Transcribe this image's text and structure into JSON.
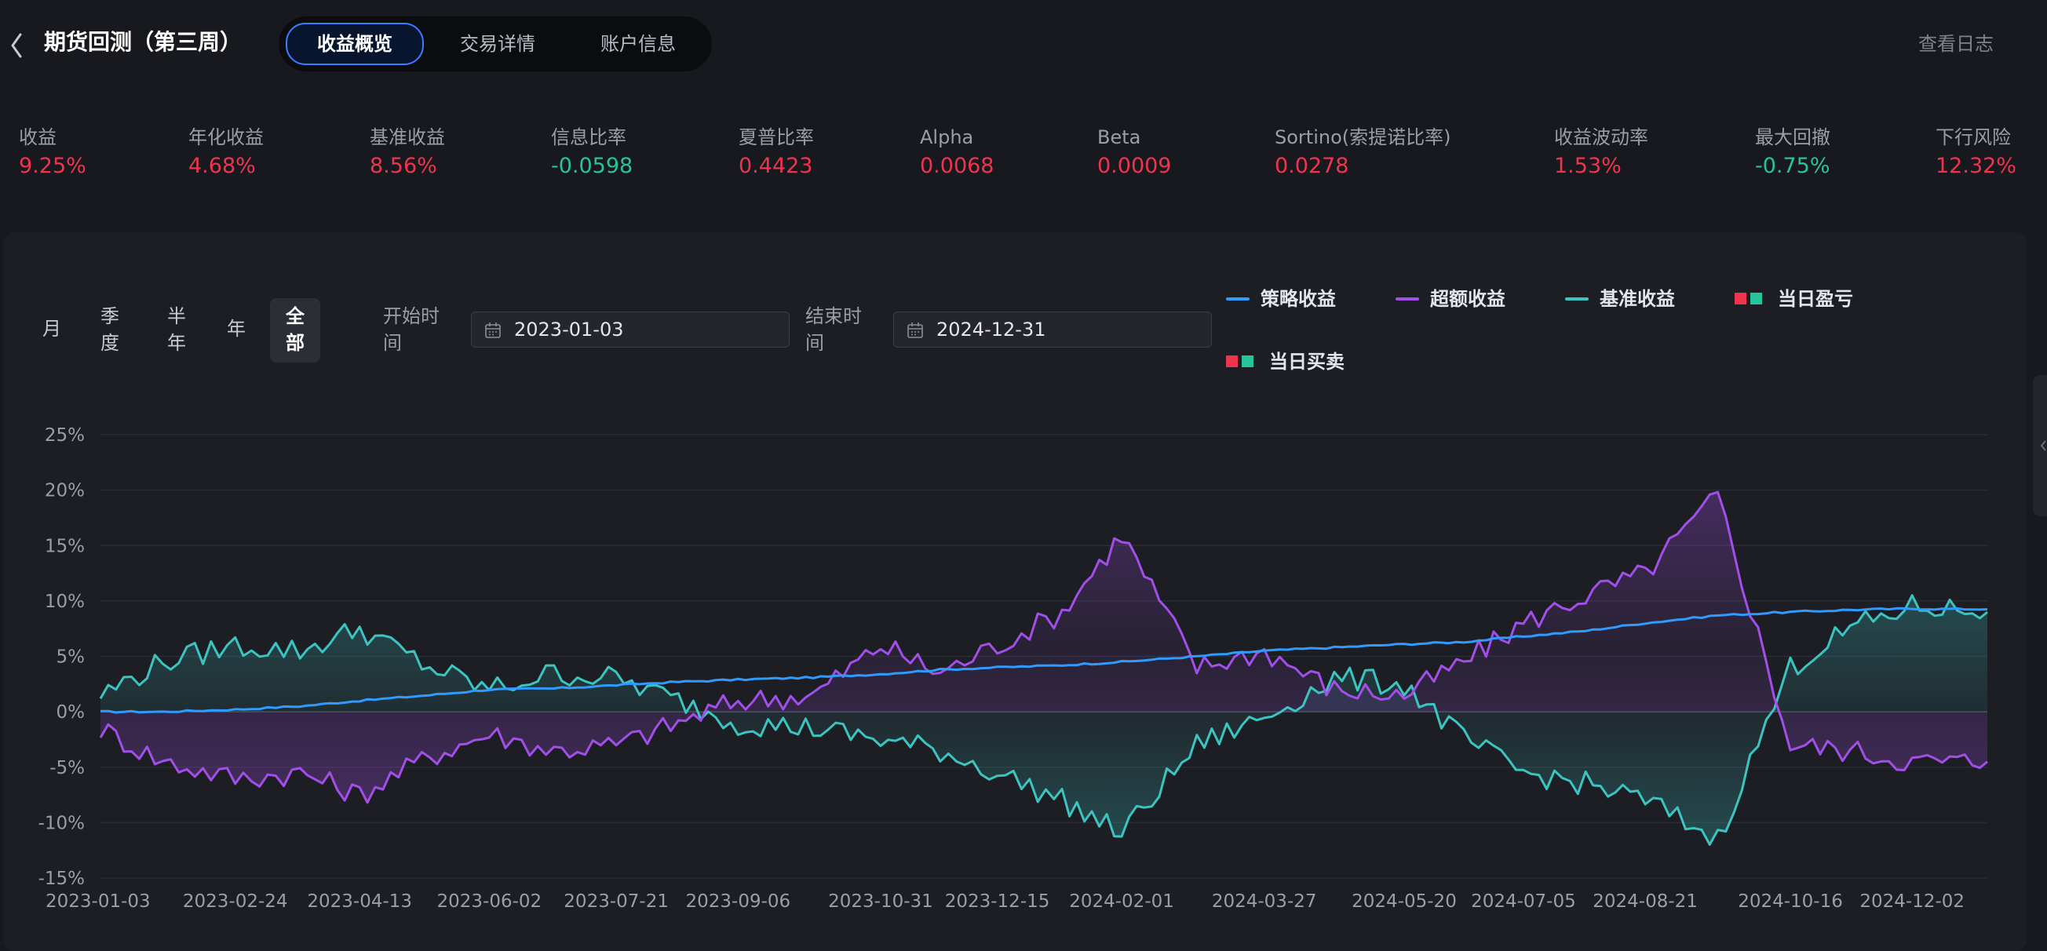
{
  "header": {
    "title": "期货回测（第三周）",
    "tabs": [
      {
        "label": "收益概览",
        "active": true
      },
      {
        "label": "交易详情",
        "active": false
      },
      {
        "label": "账户信息",
        "active": false
      }
    ],
    "log_button": "查看日志"
  },
  "metrics": [
    {
      "label": "收益",
      "value": "9.25%",
      "tone": "red"
    },
    {
      "label": "年化收益",
      "value": "4.68%",
      "tone": "red"
    },
    {
      "label": "基准收益",
      "value": "8.56%",
      "tone": "red"
    },
    {
      "label": "信息比率",
      "value": "-0.0598",
      "tone": "green"
    },
    {
      "label": "夏普比率",
      "value": "0.4423",
      "tone": "red"
    },
    {
      "label": "Alpha",
      "value": "0.0068",
      "tone": "red"
    },
    {
      "label": "Beta",
      "value": "0.0009",
      "tone": "red"
    },
    {
      "label": "Sortino(索提诺比率)",
      "value": "0.0278",
      "tone": "red"
    },
    {
      "label": "收益波动率",
      "value": "1.53%",
      "tone": "red"
    },
    {
      "label": "最大回撤",
      "value": "-0.75%",
      "tone": "green"
    },
    {
      "label": "下行风险",
      "value": "12.32%",
      "tone": "red"
    }
  ],
  "periods": [
    {
      "label": "月",
      "active": false
    },
    {
      "label": "季度",
      "active": false
    },
    {
      "label": "半年",
      "active": false
    },
    {
      "label": "年",
      "active": false
    },
    {
      "label": "全部",
      "active": true
    }
  ],
  "date_range": {
    "start_label": "开始时间",
    "start_value": "2023-01-03",
    "end_label": "结束时间",
    "end_value": "2024-12-31"
  },
  "colors": {
    "strategy": "#2f9bff",
    "excess": "#a24ee8",
    "benchmark": "#3bc4c0",
    "up": "#f0344f",
    "down": "#26c49a"
  },
  "legend": [
    {
      "label": "策略收益",
      "kind": "line",
      "color": "#2f9bff"
    },
    {
      "label": "超额收益",
      "kind": "line",
      "color": "#a24ee8"
    },
    {
      "label": "基准收益",
      "kind": "line",
      "color": "#3bc4c0"
    },
    {
      "label": "当日盈亏",
      "kind": "squares"
    },
    {
      "label": "当日买卖",
      "kind": "squares"
    }
  ],
  "chart_data": {
    "type": "line",
    "title": "",
    "xlabel": "",
    "ylabel": "",
    "ylim": [
      -15,
      25
    ],
    "y_ticks": [
      "25%",
      "20%",
      "15%",
      "10%",
      "5%",
      "0%",
      "-5%",
      "-10%",
      "-15%"
    ],
    "x_ticks": [
      "2023-01-03",
      "2023-02-24",
      "2023-04-13",
      "2023-06-02",
      "2023-07-21",
      "2023-09-06",
      "2023-10-31",
      "2023-12-15",
      "2024-02-01",
      "2024-03-27",
      "2024-05-20",
      "2024-07-05",
      "2024-08-21",
      "2024-10-16",
      "2024-12-02"
    ],
    "grid": true,
    "legend_position": "top-right",
    "x": [
      "2023-01-03",
      "2023-01-27",
      "2023-02-24",
      "2023-03-21",
      "2023-04-13",
      "2023-05-10",
      "2023-06-02",
      "2023-06-27",
      "2023-07-21",
      "2023-08-14",
      "2023-09-06",
      "2023-10-05",
      "2023-10-31",
      "2023-11-23",
      "2023-12-15",
      "2024-01-09",
      "2024-02-01",
      "2024-03-01",
      "2024-03-27",
      "2024-04-23",
      "2024-05-20",
      "2024-06-12",
      "2024-07-05",
      "2024-07-29",
      "2024-08-21",
      "2024-09-18",
      "2024-10-16",
      "2024-11-08",
      "2024-12-02",
      "2024-12-31"
    ],
    "series": [
      {
        "name": "策略收益",
        "values": [
          0.0,
          0.0,
          0.2,
          0.5,
          1.0,
          1.5,
          2.0,
          2.1,
          2.4,
          2.7,
          2.9,
          3.1,
          3.4,
          3.8,
          4.0,
          4.2,
          4.5,
          5.0,
          5.5,
          5.8,
          6.1,
          6.3,
          6.8,
          7.3,
          8.0,
          8.7,
          9.0,
          9.2,
          9.3,
          9.25
        ]
      },
      {
        "name": "超额收益",
        "values": [
          -1.5,
          -4.5,
          -6.0,
          -5.5,
          -7.5,
          -4.0,
          -2.0,
          -3.5,
          -3.0,
          -1.0,
          1.0,
          1.5,
          6.0,
          3.5,
          6.0,
          9.0,
          16.0,
          4.0,
          5.5,
          2.0,
          1.5,
          4.5,
          8.0,
          10.5,
          12.5,
          19.5,
          -3.0,
          -3.5,
          -4.5,
          -4.5
        ]
      },
      {
        "name": "基准收益",
        "values": [
          1.5,
          4.5,
          6.0,
          5.5,
          7.5,
          4.0,
          2.0,
          3.5,
          3.0,
          1.0,
          -1.0,
          -1.5,
          -2.5,
          -3.5,
          -5.5,
          -8.0,
          -11.0,
          -3.0,
          -0.5,
          3.0,
          2.5,
          -2.5,
          -5.5,
          -6.5,
          -8.0,
          -11.5,
          4.0,
          7.5,
          9.5,
          9.0
        ]
      }
    ]
  }
}
